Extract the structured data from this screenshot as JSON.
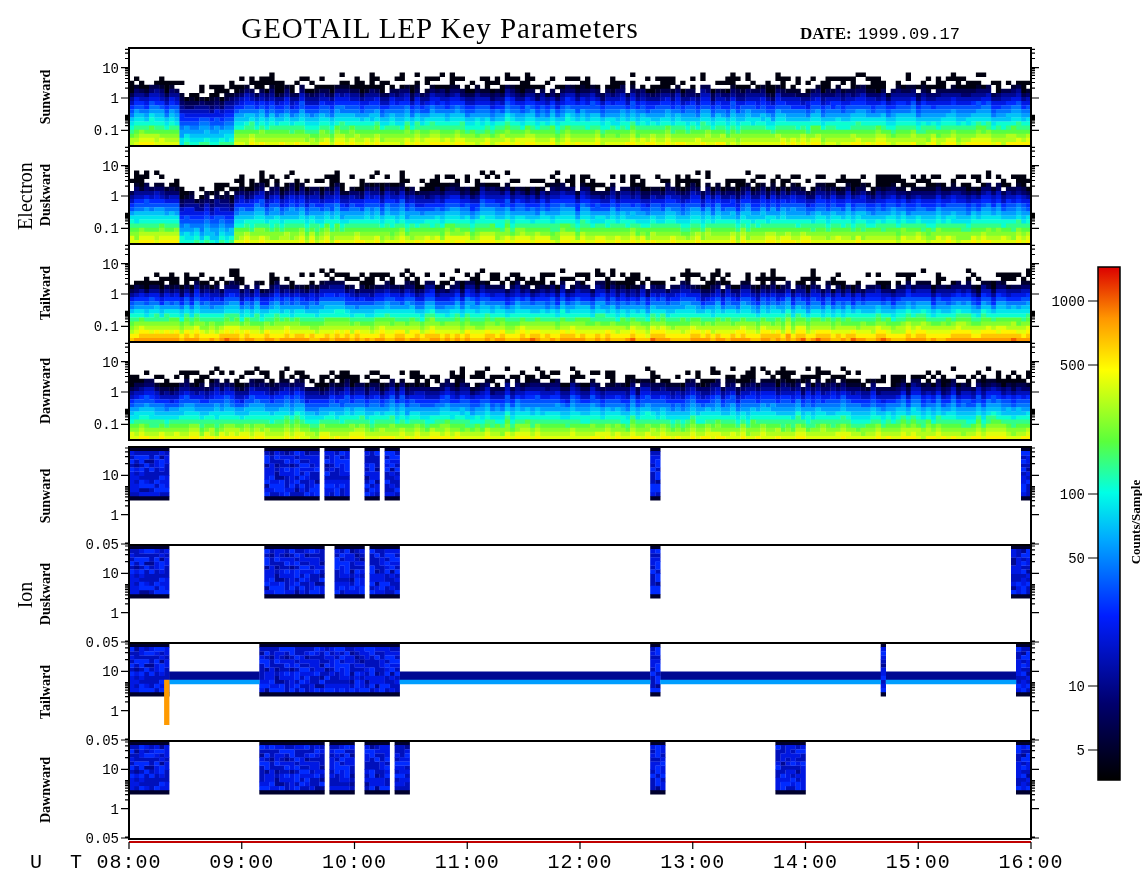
{
  "title": "GEOTAIL LEP Key Parameters",
  "date": {
    "label": "DATE:",
    "value": "1999.09.17"
  },
  "groups": [
    {
      "name": "Electron",
      "kind": "electron",
      "panels": [
        {
          "label": "Sunward",
          "y_ticks": [
            "10",
            "1",
            "0.1"
          ]
        },
        {
          "label": "Duskward",
          "y_ticks": [
            "10",
            "1",
            "0.1"
          ]
        },
        {
          "label": "Tailward",
          "y_ticks": [
            "10",
            "1",
            "0.1"
          ]
        },
        {
          "label": "Dawnward",
          "y_ticks": [
            "10",
            "1",
            "0.1"
          ]
        }
      ]
    },
    {
      "name": "Ion",
      "kind": "ion",
      "panels": [
        {
          "label": "Sunward",
          "y_ticks": [
            "10",
            "1",
            "0.05"
          ]
        },
        {
          "label": "Duskward",
          "y_ticks": [
            "10",
            "1",
            "0.05"
          ]
        },
        {
          "label": "Tailward",
          "y_ticks": [
            "10",
            "1",
            "0.05"
          ]
        },
        {
          "label": "Dawnward",
          "y_ticks": [
            "10",
            "1",
            "0.05"
          ]
        }
      ]
    }
  ],
  "x_axis": {
    "label": "U T",
    "ticks": [
      "08:00",
      "09:00",
      "10:00",
      "11:00",
      "12:00",
      "13:00",
      "14:00",
      "15:00",
      "16:00"
    ]
  },
  "colorbar": {
    "label": "Counts/Sample",
    "ticks": [
      "1000",
      "500",
      "100",
      "50",
      "10",
      "5"
    ]
  }
}
